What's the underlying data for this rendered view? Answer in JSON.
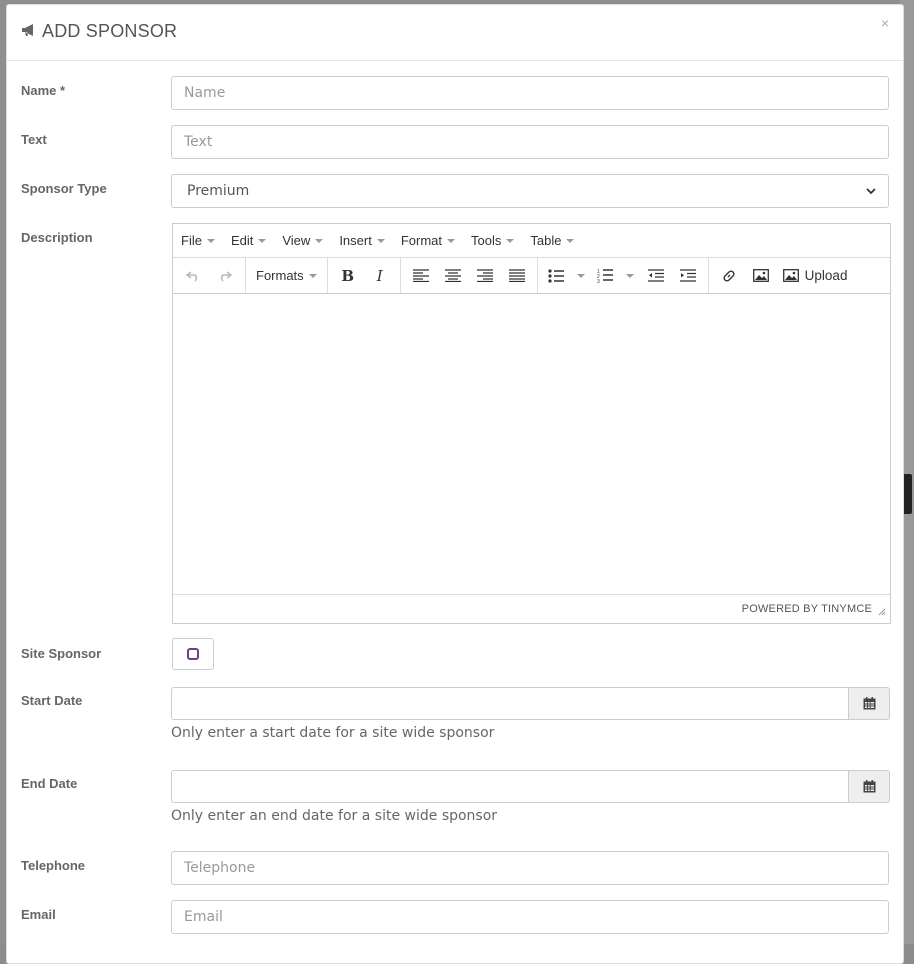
{
  "modal": {
    "title": "ADD SPONSOR",
    "title_icon": "bullhorn-icon",
    "close_label": "×"
  },
  "fields": {
    "name": {
      "label": "Name *",
      "placeholder": "Name"
    },
    "text": {
      "label": "Text",
      "placeholder": "Text"
    },
    "sponsor_type": {
      "label": "Sponsor Type",
      "value": "Premium"
    },
    "description": {
      "label": "Description"
    },
    "site_sponsor": {
      "label": "Site Sponsor"
    },
    "start_date": {
      "label": "Start Date",
      "help": "Only enter a start date for a site wide sponsor"
    },
    "end_date": {
      "label": "End Date",
      "help": "Only enter an end date for a site wide sponsor"
    },
    "telephone": {
      "label": "Telephone",
      "placeholder": "Telephone"
    },
    "email": {
      "label": "Email",
      "placeholder": "Email"
    }
  },
  "editor": {
    "menu": [
      "File",
      "Edit",
      "View",
      "Insert",
      "Format",
      "Tools",
      "Table"
    ],
    "formats_label": "Formats",
    "upload_label": "Upload",
    "powered_by": "POWERED BY TINYMCE"
  },
  "colors": {
    "accent": "#6b3f8c",
    "border": "#cccccc"
  }
}
